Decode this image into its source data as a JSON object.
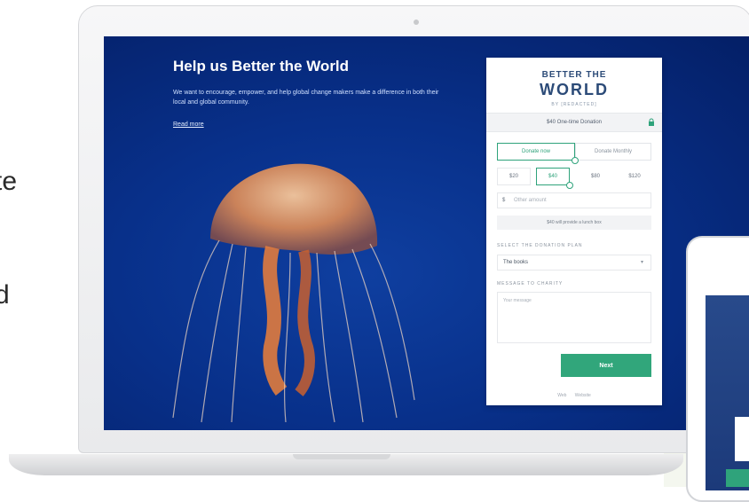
{
  "page": {
    "left_fragments": [
      "te",
      "d"
    ]
  },
  "hero": {
    "title": "Help us Better the World",
    "description": "We want to encourage, empower, and help global change makers make a difference in both their local and global community.",
    "read_more": "Read more"
  },
  "form": {
    "logo_line1": "BETTER THE",
    "logo_line2": "WORLD",
    "logo_sub": "BY [REDACTED]",
    "summary": "$40 One-time Donation",
    "toggle": {
      "one_time": "Donate now",
      "monthly": "Donate Monthly"
    },
    "amounts": [
      "$20",
      "$40",
      "$80",
      "$120"
    ],
    "selected_amount": "$40",
    "other": {
      "currency": "$",
      "placeholder": "Other amount"
    },
    "impact": "$40 will provide a lunch box",
    "plan_label": "SELECT THE DONATION PLAN",
    "plan_value": "The books",
    "message_label": "MESSAGE TO CHARITY",
    "message_placeholder": "Your message",
    "next": "Next",
    "footer": [
      "Web",
      "Website"
    ]
  },
  "colors": {
    "accent": "#31a67b",
    "hero_bg": "#08308a",
    "logo": "#2c4b78"
  },
  "icons": {
    "lock": "lock-icon",
    "dropdown": "chevron-down-icon"
  }
}
